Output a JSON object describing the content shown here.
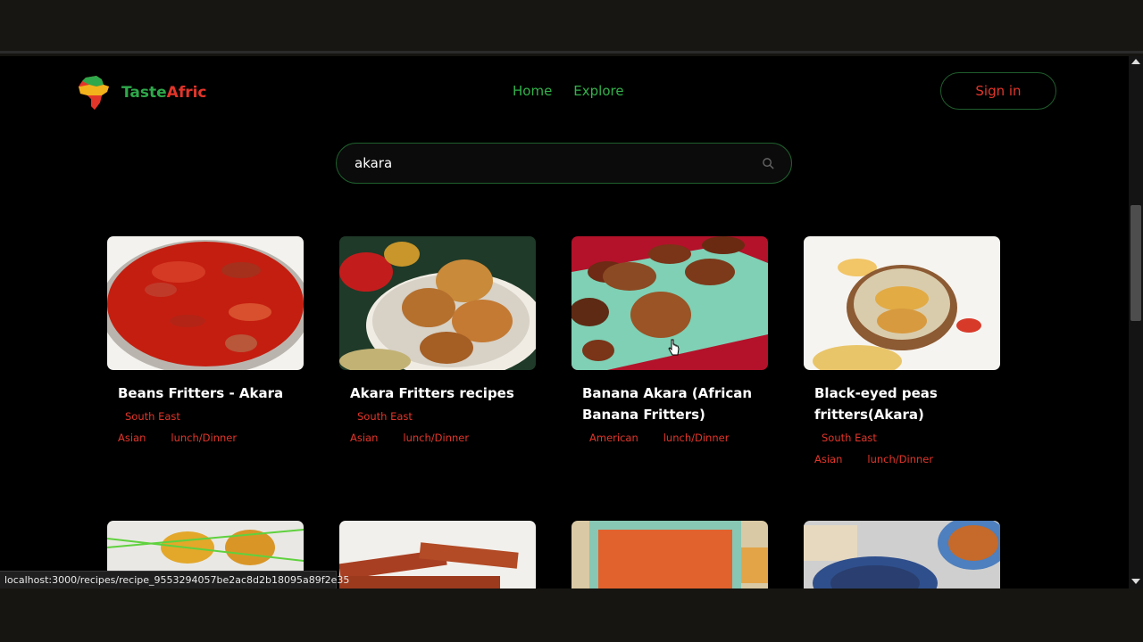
{
  "brand": {
    "name_part1": "Taste",
    "name_part2": "Afric"
  },
  "nav": {
    "home": "Home",
    "explore": "Explore"
  },
  "auth": {
    "signin": "Sign in"
  },
  "search": {
    "value": "akara",
    "icon": "search-icon"
  },
  "recipes": [
    {
      "title": "Beans Fritters - Akara",
      "region": "South East",
      "cuisine": "Asian",
      "meal": "lunch/Dinner"
    },
    {
      "title": "Akara Fritters recipes",
      "region": "South East",
      "cuisine": "Asian",
      "meal": "lunch/Dinner"
    },
    {
      "title": "Banana Akara (African Banana Fritters)",
      "region": "",
      "cuisine": "American",
      "meal": "lunch/Dinner"
    },
    {
      "title": "Black-eyed peas fritters(Akara)",
      "region": "South East",
      "cuisine": "Asian",
      "meal": "lunch/Dinner"
    }
  ],
  "status": {
    "url": "localhost:3000/recipes/recipe_9553294057be2ac8d2b18095a89f2e35"
  },
  "colors": {
    "green": "#33b14b",
    "red": "#e2352a",
    "background": "#000000"
  }
}
